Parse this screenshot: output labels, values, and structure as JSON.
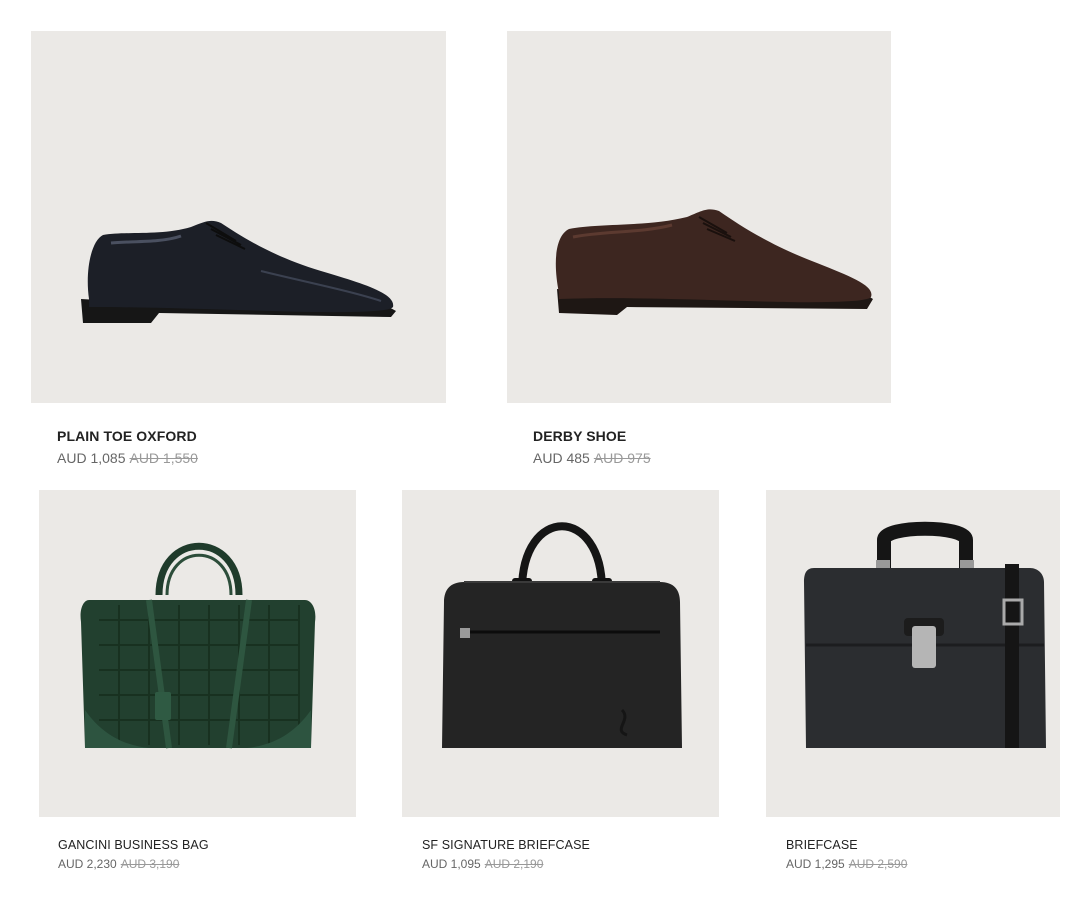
{
  "products": [
    {
      "name": "PLAIN TOE OXFORD",
      "price": "AUD 1,085",
      "original_price": "AUD 1,550",
      "image": "black-oxford-shoe"
    },
    {
      "name": "DERBY SHOE",
      "price": "AUD 485",
      "original_price": "AUD 975",
      "image": "brown-derby-shoe"
    },
    {
      "name": "GANCINI BUSINESS BAG",
      "price": "AUD 2,230",
      "original_price": "AUD 3,190",
      "image": "green-gancini-bag"
    },
    {
      "name": "SF SIGNATURE BRIEFCASE",
      "price": "AUD 1,095",
      "original_price": "AUD 2,190",
      "image": "black-briefcase"
    },
    {
      "name": "BRIEFCASE",
      "price": "AUD 1,295",
      "original_price": "AUD 2,590",
      "image": "black-flap-briefcase"
    }
  ],
  "colors": {
    "image_bg": "#ebe9e6",
    "text": "#222222",
    "price": "#666666",
    "original_price": "#999999"
  }
}
